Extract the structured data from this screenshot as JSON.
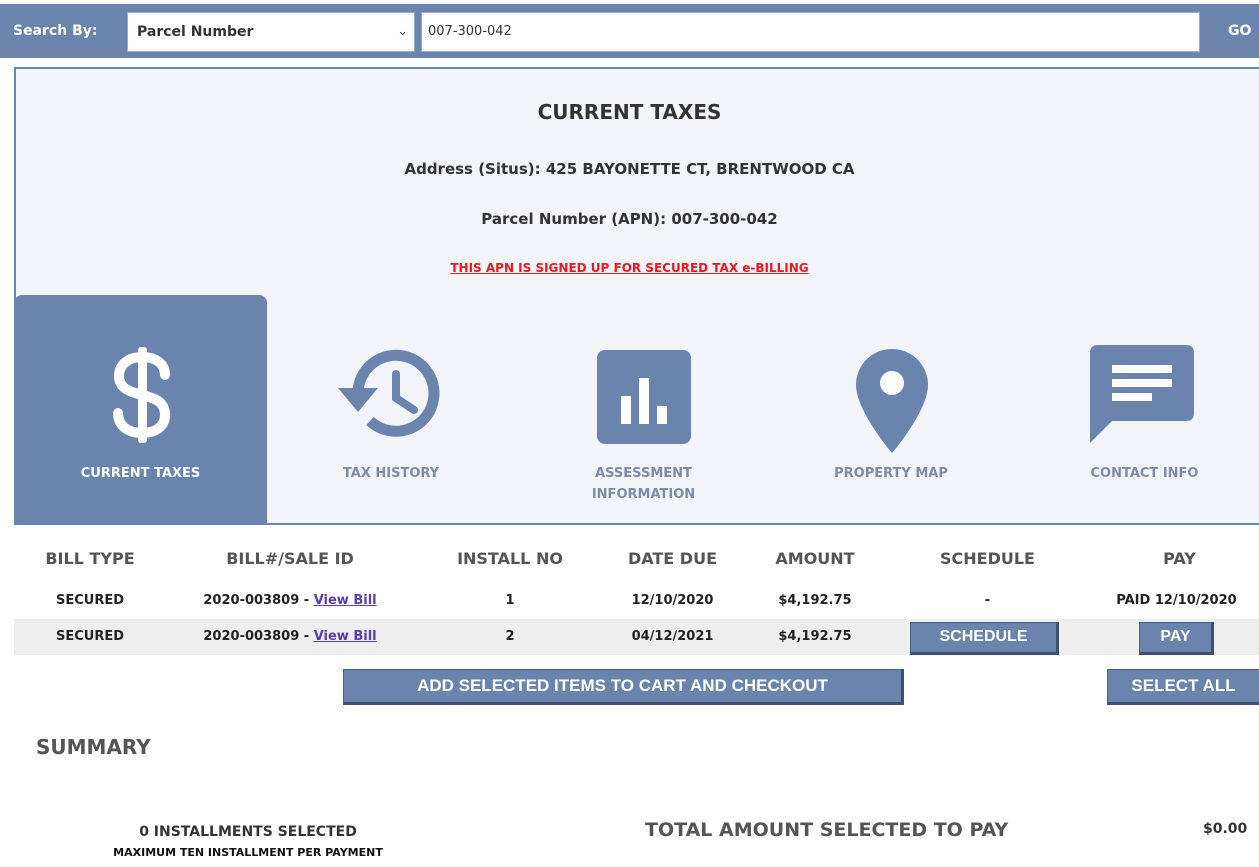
{
  "search": {
    "label": "Search By:",
    "type_selected": "Parcel Number",
    "query_value": "007-300-042",
    "go_label": "GO"
  },
  "header": {
    "title": "CURRENT TAXES",
    "address": "Address (Situs): 425 BAYONETTE CT, BRENTWOOD CA",
    "parcel": "Parcel Number (APN): 007-300-042",
    "ebilling_notice": "THIS APN IS SIGNED UP FOR SECURED TAX e-BILLING"
  },
  "tabs": [
    {
      "label": "CURRENT TAXES",
      "icon": "dollar-icon",
      "active": true
    },
    {
      "label": "TAX HISTORY",
      "icon": "history-icon",
      "active": false
    },
    {
      "label": "ASSESSMENT INFORMATION",
      "icon": "bar-chart-icon",
      "active": false
    },
    {
      "label": "PROPERTY MAP",
      "icon": "map-pin-icon",
      "active": false
    },
    {
      "label": "CONTACT INFO",
      "icon": "message-icon",
      "active": false
    }
  ],
  "table": {
    "headers": [
      "BILL TYPE",
      "BILL#/SALE ID",
      "INSTALL NO",
      "DATE DUE",
      "AMOUNT",
      "SCHEDULE",
      "PAY"
    ],
    "rows": [
      {
        "bill_type": "SECURED",
        "bill_id": "2020-003809 - ",
        "view_link": "View Bill",
        "install_no": "1",
        "date_due": "12/10/2020",
        "amount": "$4,192.75",
        "schedule": "-",
        "pay": "PAID 12/10/2020"
      },
      {
        "bill_type": "SECURED",
        "bill_id": "2020-003809 - ",
        "view_link": "View Bill",
        "install_no": "2",
        "date_due": "04/12/2021",
        "amount": "$4,192.75",
        "schedule_button": "SCHEDULE",
        "pay_button": "PAY"
      }
    ]
  },
  "actions": {
    "add_to_cart": "ADD SELECTED ITEMS TO CART AND CHECKOUT",
    "select_all": "SELECT ALL"
  },
  "summary": {
    "heading": "SUMMARY",
    "installments_selected": "0 INSTALLMENTS SELECTED",
    "max_note": "MAXIMUM TEN INSTALLMENT PER PAYMENT",
    "total_label": "TOTAL AMOUNT SELECTED TO PAY",
    "total_value": "$0.00"
  },
  "colors": {
    "accent": "#6b84ad",
    "warning": "#e8191f",
    "link": "#5b3bb0"
  }
}
